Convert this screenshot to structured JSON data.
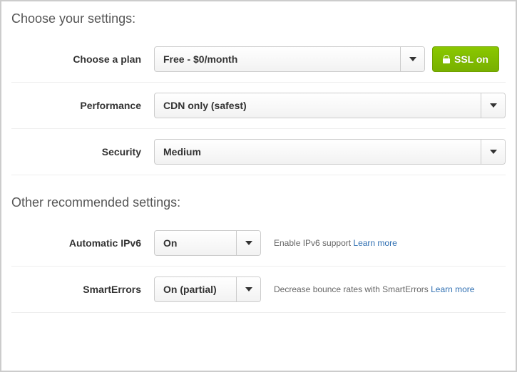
{
  "section1": {
    "title": "Choose your settings:"
  },
  "plan": {
    "label": "Choose a plan",
    "value": "Free - $0/month",
    "ssl_label": "SSL on"
  },
  "performance": {
    "label": "Performance",
    "value": "CDN only (safest)"
  },
  "security": {
    "label": "Security",
    "value": "Medium"
  },
  "section2": {
    "title": "Other recommended settings:"
  },
  "ipv6": {
    "label": "Automatic IPv6",
    "value": "On",
    "help": "Enable IPv6 support ",
    "learn_more": "Learn more"
  },
  "smarterrors": {
    "label": "SmartErrors",
    "value": "On (partial)",
    "help": "Decrease bounce rates with SmartErrors ",
    "learn_more": "Learn more"
  }
}
